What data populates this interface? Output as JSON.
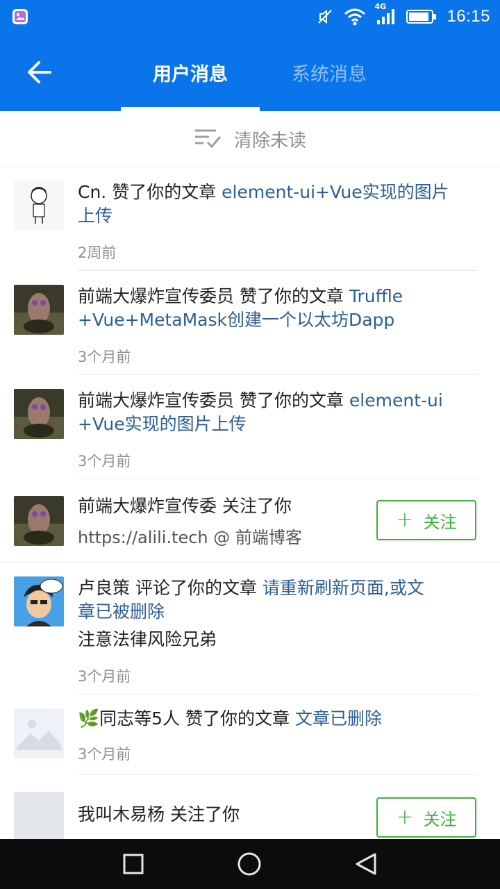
{
  "status_bar": {
    "time": "16:15",
    "network": "4G",
    "icons": [
      "gallery-icon",
      "mute-icon",
      "wifi-icon",
      "signal-icon",
      "battery-icon"
    ]
  },
  "header": {
    "tabs": [
      {
        "label": "用户消息",
        "active": true
      },
      {
        "label": "系统消息",
        "active": false
      }
    ],
    "back_icon": "back-arrow-icon"
  },
  "clear_unread": {
    "label": "清除未读",
    "icon": "mark-read-icon"
  },
  "messages": [
    {
      "user": "Cn.",
      "action": " 赞了你的文章 ",
      "article_line1": "element-ui+Vue实现的图片",
      "article_line2": "上传",
      "time": "2周前"
    },
    {
      "user": "前端大爆炸宣传委员",
      "action": " 赞了你的文章 ",
      "article_line1": "Truffle",
      "article_line2": "+Vue+MetaMask创建一个以太坊Dapp",
      "time": "3个月前"
    },
    {
      "user": "前端大爆炸宣传委员",
      "action": " 赞了你的文章 ",
      "article_line1": "element-ui",
      "article_line2": "+Vue实现的图片上传",
      "time": "3个月前"
    },
    {
      "user": "前端大爆炸宣传委",
      "action": " 关注了你",
      "bio": "https://alili.tech @ 前端博客",
      "follow_label": "关注"
    },
    {
      "user": "卢良策",
      "action": " 评论了你的文章 ",
      "article_line1": "请重新刷新页面,或文",
      "article_line2": "章已被删除",
      "comment": "注意法律风险兄弟",
      "time": "3个月前"
    },
    {
      "user": "🌿同志等5人",
      "action": " 赞了你的文章 ",
      "article_line1": "文章已删除",
      "time": "3个月前"
    },
    {
      "user": "我叫木易杨",
      "action": " 关注了你",
      "follow_label": "关注"
    }
  ],
  "nav_bar": {
    "icons": [
      "recent-apps-icon",
      "home-icon",
      "back-icon"
    ]
  },
  "colors": {
    "primary": "#0a74ea",
    "link": "#2a5e98",
    "follow": "#3cb13c",
    "muted": "#8c9097"
  }
}
